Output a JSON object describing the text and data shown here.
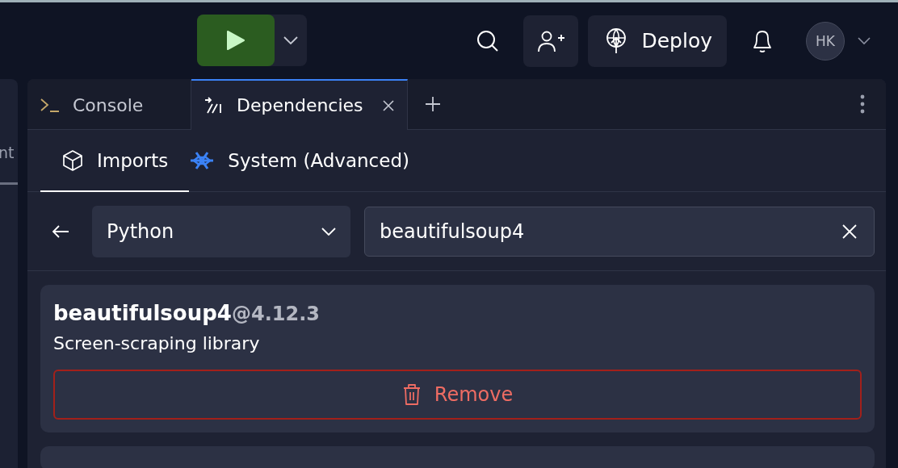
{
  "top_bar": {
    "deploy_label": "Deploy",
    "avatar_initials": "HK"
  },
  "left_panel": {
    "label": "nt"
  },
  "tabs": [
    {
      "label": "Console",
      "kind": "console",
      "selected": false,
      "closable": false
    },
    {
      "label": "Dependencies",
      "kind": "dependencies",
      "selected": true,
      "closable": true
    }
  ],
  "subtabs": [
    {
      "label": "Imports",
      "kind": "cube",
      "selected": true
    },
    {
      "label": "System (Advanced)",
      "kind": "snowflake",
      "selected": false
    }
  ],
  "toolbar": {
    "language": "Python",
    "search_value": "beautifulsoup4"
  },
  "packages": [
    {
      "name": "beautifulsoup4",
      "version": "@4.12.3",
      "description": "Screen-scraping library",
      "action": "Remove"
    }
  ]
}
